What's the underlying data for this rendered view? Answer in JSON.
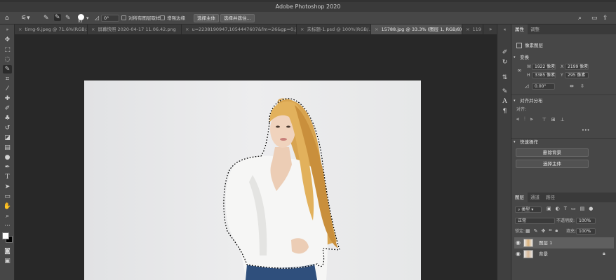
{
  "app": {
    "title": "Adobe Photoshop 2020"
  },
  "options_bar": {
    "brush_size": "93",
    "angle_value": "0°",
    "sample_all_layers_label": "对所有图层取样",
    "enhance_edge_label": "增强边缘",
    "select_subject_label": "选择主体",
    "select_and_mask_label": "选择并遮住..."
  },
  "tabs": [
    {
      "label": "timg-9.jpeg @ 71.6%(RGB/...",
      "active": false
    },
    {
      "label": "屏幕快照 2020-04-17 11.06.42.png",
      "active": false
    },
    {
      "label": "u=2238190947,1054447607&fm=26&gp=0.jpg",
      "active": false
    },
    {
      "label": "未标题-1.psd @ 100%(RGB/...",
      "active": false
    },
    {
      "label": "15788.jpg @ 33.3% (图层 1, RGB/8) *",
      "active": true
    },
    {
      "label": "119",
      "active": false
    }
  ],
  "properties_panel": {
    "tab_properties": "属性",
    "tab_adjustments": "调整",
    "layer_type": "像素图层",
    "transform_title": "变换",
    "w_label": "W",
    "w_value": "1922 像素",
    "x_label": "X",
    "x_value": "2199 像素",
    "h_label": "H",
    "h_value": "3385 像素",
    "y_label": "Y",
    "y_value": "295 像素",
    "angle_value": "0.00°",
    "align_title": "对齐并分布",
    "align_label": "对齐:",
    "more_label": "•••",
    "quick_actions_title": "快速操作",
    "remove_bg_label": "删除背景",
    "select_subject_label": "选择主体"
  },
  "layers_panel": {
    "tab_layers": "图层",
    "tab_channels": "通道",
    "tab_paths": "路径",
    "filter_kind": "类型",
    "blend_mode": "正常",
    "opacity_label": "不透明度:",
    "opacity_value": "100%",
    "lock_label": "锁定:",
    "fill_label": "填充:",
    "fill_value": "100%",
    "layers": [
      {
        "name": "图层 1",
        "selected": true
      },
      {
        "name": "背景",
        "selected": false,
        "locked": true
      }
    ]
  },
  "colors": {
    "foreground": "#ffffff",
    "background": "#000000",
    "selection_marching_ants": "#000000"
  }
}
